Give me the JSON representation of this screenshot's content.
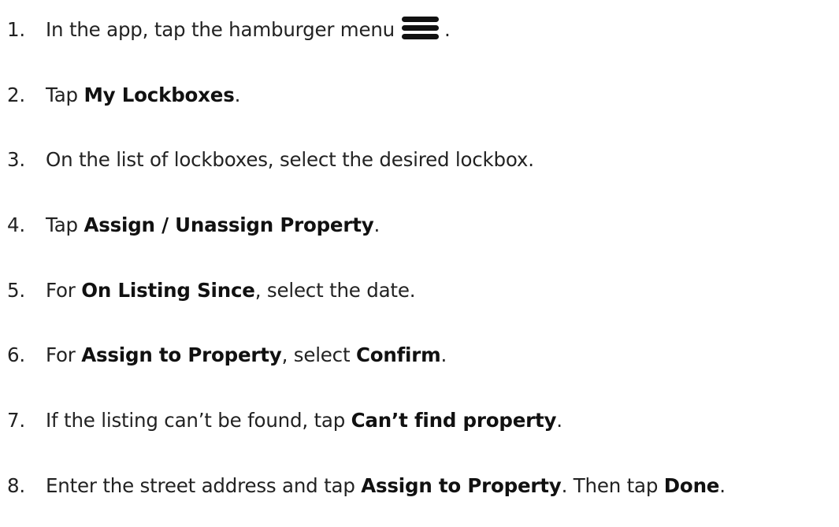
{
  "steps": [
    {
      "number": "1.",
      "text_1": "In the app, tap the hamburger menu",
      "icon": "hamburger-menu-icon",
      "text_2": "."
    },
    {
      "number": "2.",
      "text_1": "Tap ",
      "bold_1": "My Lockboxes",
      "text_2": "."
    },
    {
      "number": "3.",
      "text_1": "On the list of lockboxes, select the desired lockbox."
    },
    {
      "number": "4.",
      "text_1": "Tap ",
      "bold_1": "Assign / Unassign Property",
      "text_2": "."
    },
    {
      "number": "5.",
      "text_1": "For ",
      "bold_1": "On Listing Since",
      "text_2": ", select the date."
    },
    {
      "number": "6.",
      "text_1": "For ",
      "bold_1": "Assign to Property",
      "text_2": ", select ",
      "bold_2": "Confirm",
      "text_3": "."
    },
    {
      "number": "7.",
      "text_1": "If the listing can’t be found, tap ",
      "bold_1": "Can’t find property",
      "text_2": "."
    },
    {
      "number": "8.",
      "text_1": "Enter the street address and tap ",
      "bold_1": "Assign to Property",
      "text_2": ". Then tap ",
      "bold_2": "Done",
      "text_3": "."
    }
  ]
}
